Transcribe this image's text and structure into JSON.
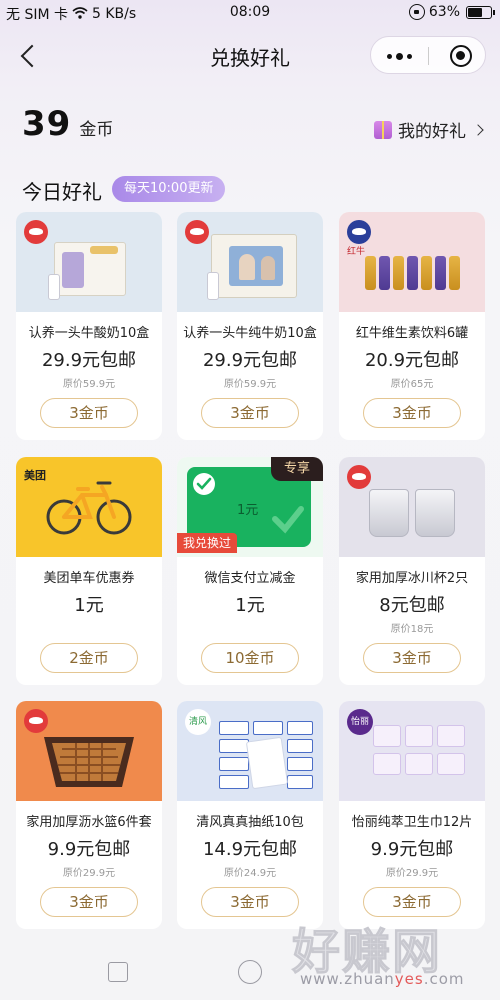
{
  "status_bar": {
    "carrier": "无 SIM 卡",
    "network_speed": "5 KB/s",
    "time": "08:09",
    "battery": "63%"
  },
  "nav": {
    "title": "兑换好礼"
  },
  "coins": {
    "amount": "39",
    "unit": "金币"
  },
  "my_gifts_label": "我的好礼",
  "section": {
    "title": "今日好礼",
    "badge": "每天10:00更新"
  },
  "products": [
    {
      "name": "认养一头牛酸奶10盒",
      "price": "29.9元包邮",
      "original": "原价59.9元",
      "cost": "3金币",
      "bg": "#dfe8f1"
    },
    {
      "name": "认养一头牛纯牛奶10盒",
      "price": "29.9元包邮",
      "original": "原价59.9元",
      "cost": "3金币",
      "bg": "#dfe8f1"
    },
    {
      "name": "红牛维生素饮料6罐",
      "price": "20.9元包邮",
      "original": "原价65元",
      "cost": "3金币",
      "bg": "#f4dde0"
    },
    {
      "name": "美团单车优惠券",
      "price": "1元",
      "original": "",
      "cost": "2金币",
      "bg": "#f8c52a"
    },
    {
      "name": "微信支付立减金",
      "price": "1元",
      "original": "",
      "cost": "10金币",
      "bg": "#eef9f1"
    },
    {
      "name": "家用加厚冰川杯2只",
      "price": "8元包邮",
      "original": "原价18元",
      "cost": "3金币",
      "bg": "#e4e2eb"
    },
    {
      "name": "家用加厚沥水篮6件套",
      "price": "9.9元包邮",
      "original": "原价29.9元",
      "cost": "3金币",
      "bg": "#f08a4c"
    },
    {
      "name": "清风真真抽纸10包",
      "price": "14.9元包邮",
      "original": "原价24.9元",
      "cost": "3金币",
      "bg": "#dde5f4"
    },
    {
      "name": "怡丽纯萃卫生巾12片",
      "price": "9.9元包邮",
      "original": "原价29.9元",
      "cost": "3金币",
      "bg": "#e6e4f1"
    }
  ],
  "tags": {
    "exclusive": "专享",
    "exchanged": "我兑换过",
    "wechat_amount": "1元",
    "meituan_logo": "美团",
    "redbull_logo": "红牛",
    "qingfeng_logo": "清风",
    "whisper_logo": "怡丽"
  },
  "watermark": {
    "big": "好赚网",
    "small_prefix": "www.zhuan",
    "small_highlight": "yes",
    "small_suffix": ".com"
  },
  "icons": {
    "back": "chevron-left-icon",
    "more": "more-dots-icon",
    "close": "target-circle-icon",
    "gift": "gift-icon"
  },
  "colors": {
    "accent_badge": "#a989e8",
    "button_border": "#e4c692",
    "button_text": "#8c6a33",
    "exchanged_tag": "#e74a3a"
  }
}
